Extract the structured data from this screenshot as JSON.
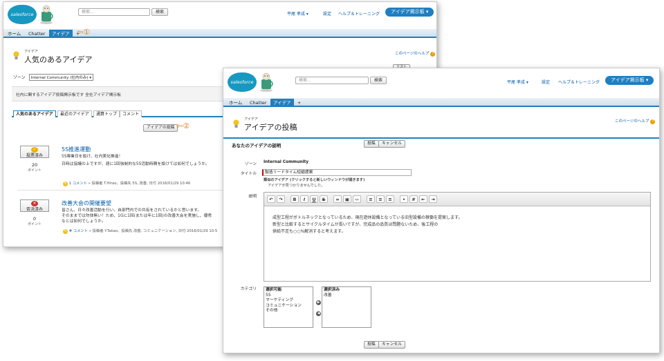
{
  "back": {
    "header": {
      "logo": "salesforce",
      "search_placeholder": "検索...",
      "search_button": "検索",
      "user_menu": "平尾 孝成 ▾",
      "setup_link": "設定",
      "help_link": "ヘルプ＆トレーニング",
      "app_menu": "アイデア掲示板 ▾"
    },
    "tabs": [
      "ホーム",
      "Chatter",
      "アイデア",
      "+"
    ],
    "active_tab": "アイデア",
    "callout1": "⇦①",
    "page_kicker": "アイデア",
    "page_title": "人気のあるアイデア",
    "help_link": "このページのヘルプ",
    "zone_label": "ゾーン",
    "zone_value": "Internal Community (社内のみ) ▾",
    "view_toggle": "リスト",
    "description": "社内に関するアイデア投稿掲示板です 全社アイデア掲示板",
    "subtabs": [
      "人気のあるアイデア",
      "最近のアイデア",
      "通算トップ",
      "コメント"
    ],
    "post_button": "アイデアの投稿",
    "callout2": "⇦②",
    "ideas": [
      {
        "vote_label": "投票済み",
        "points": "20",
        "points_unit": "ポイント",
        "title": "5S推進運動",
        "body1": "5S専業日を設け、社内美化推進！",
        "body2": "日時は協議の上ですが、週に1回強制的な5S活動時間を設けては如何でしょうか。",
        "meta_comments": "1 コメント »",
        "meta_rest": "投稿者 T.Hirao、投稿先 5S, 改善, 日付 2016/01/29 10:46"
      },
      {
        "vote_label": "否決済み",
        "points": "0",
        "points_unit": "ポイント",
        "title": "改善大会の開催要望",
        "body1": "皆さん、日々改善活動を行い、自部門内での共有をされているかと思います。",
        "body2": "そのままでは勿体無い！ため、1Gに1回(または年に1回)の改善大会を実施し、優秀",
        "body3": "なとは如何でしょうか。",
        "meta_comments": "# コメント »",
        "meta_rest": "投稿者 Y.Takao、投稿先 改善, コミュニケーション, 日付 2016/01/29 10:5"
      }
    ]
  },
  "front": {
    "header": {
      "logo": "salesforce",
      "search_placeholder": "検索...",
      "search_button": "検索",
      "user_menu": "平尾 孝成 ▾",
      "setup_link": "設定",
      "help_link": "ヘルプ＆トレーニング",
      "app_menu": "アイデア掲示板 ▾"
    },
    "tabs": [
      "ホーム",
      "Chatter",
      "アイデア",
      "+"
    ],
    "active_tab": "アイデア",
    "page_kicker": "アイデア",
    "page_title": "アイデアの投稿",
    "help_link": "このページのヘルプ",
    "section_title": "あなたのアイデアの説明",
    "post_button": "投稿",
    "cancel_button": "キャンセル",
    "zone_label": "ゾーン",
    "zone_value": "Internal Community",
    "title_label": "タイトル",
    "title_value": "製造リードタイム短縮提案",
    "similar_hint": "類似のアイデア (クリックすると新しいウィンドウが開きます)",
    "similar_none": "アイデアが見つかりませんでした。",
    "desc_label": "説明",
    "editor_lines": [
      "成型工程がボトルネックとなっているため、現在遊休設備となっている旧型設備の稼働を提案します。",
      "新型と比較するとサイクルタイムが長いですが、完成品の品質は問題ないため、後工程の",
      "供給不足も○○%解消すると考えます。"
    ],
    "category_label": "カテゴリ",
    "available_header": "選択可能",
    "available": [
      "5S",
      "マーケティング",
      "コミュニケーション",
      "その他"
    ],
    "selected_header": "選択済み",
    "selected": [
      "改善"
    ]
  }
}
